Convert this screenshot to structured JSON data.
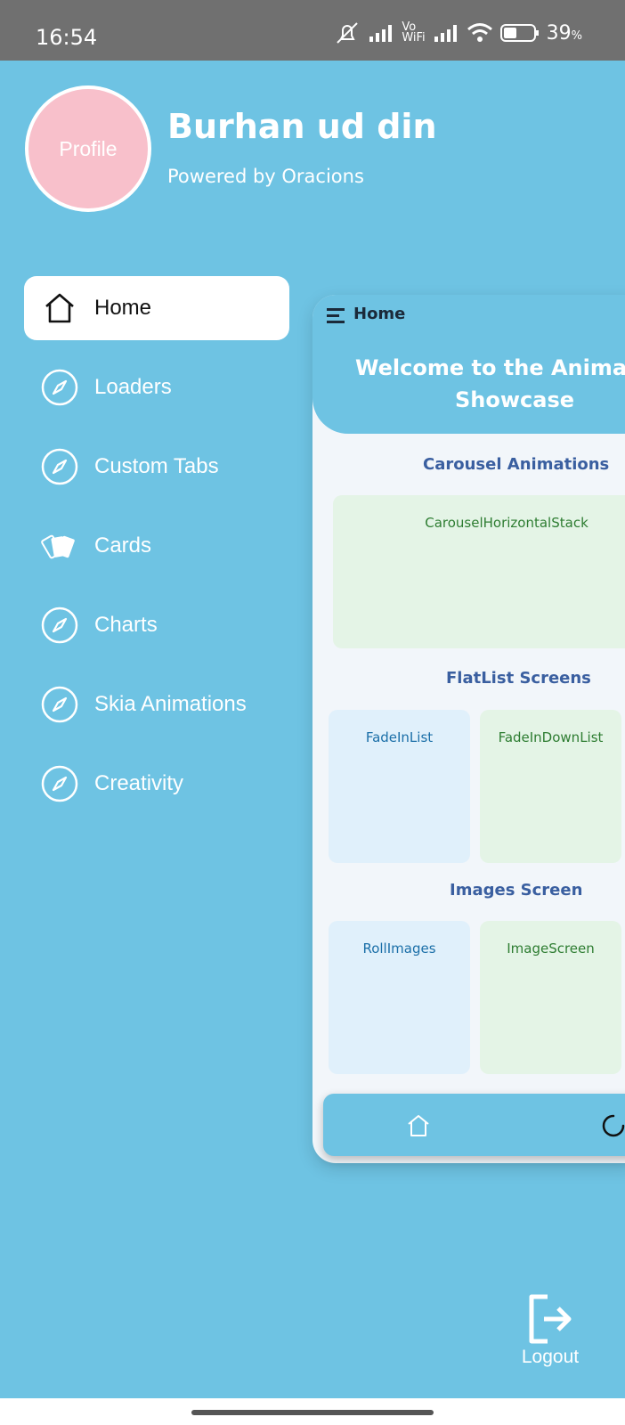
{
  "status_bar": {
    "time": "16:54",
    "network_label_top": "Vo",
    "network_label_bottom": "WiFi",
    "battery_percent": "39",
    "battery_percent_sign": "%",
    "icons": [
      "mute-icon",
      "signal-icon",
      "vowifi-icon",
      "signal-icon",
      "wifi-icon",
      "battery-icon"
    ]
  },
  "profile": {
    "avatar_label": "Profile",
    "name": "Burhan ud din",
    "subtitle": "Powered by Oracions"
  },
  "drawer": {
    "items": [
      {
        "label": "Home",
        "icon": "home-icon",
        "active": true
      },
      {
        "label": "Loaders",
        "icon": "compass-icon"
      },
      {
        "label": "Custom Tabs",
        "icon": "compass-icon"
      },
      {
        "label": "Cards",
        "icon": "cards-icon"
      },
      {
        "label": "Charts",
        "icon": "compass-icon"
      },
      {
        "label": "Skia Animations",
        "icon": "compass-icon"
      },
      {
        "label": "Creativity",
        "icon": "compass-icon"
      }
    ]
  },
  "preview": {
    "header_title": "Home",
    "banner_line1": "Welcome to the Anima",
    "banner_line2": "Showcase",
    "sections": [
      {
        "title": "Carousel Animations",
        "tiles": [
          "CarouselHorizontalStack"
        ]
      },
      {
        "title": "FlatList Screens",
        "tiles": [
          "FadeInList",
          "FadeInDownList"
        ]
      },
      {
        "title": "Images Screen",
        "tiles": [
          "RollImages",
          "ImageScreen"
        ]
      }
    ]
  },
  "bottom_tabs": [
    "home-icon",
    "loader-icon"
  ],
  "logout": {
    "label": "Logout"
  },
  "colors": {
    "drawer_bg": "#6EC3E3",
    "active_item_bg": "#FFFFFF",
    "avatar_bg": "#F8C0CB",
    "section_title": "#3A5FA0",
    "green_tile": "#E4F4E6",
    "blue_tile": "#E0F0FB"
  }
}
